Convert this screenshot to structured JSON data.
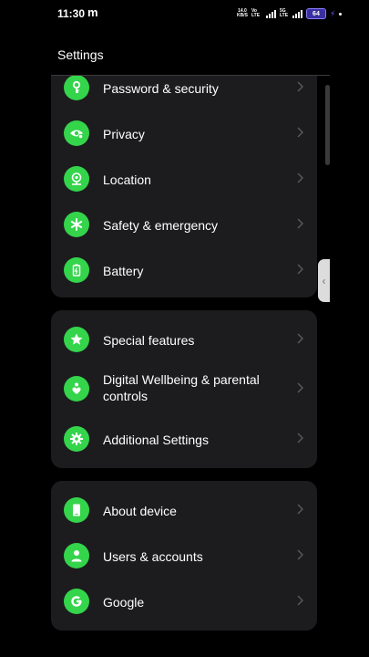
{
  "status_bar": {
    "time": "11:30",
    "app_indicator": "m",
    "net_speed_value": "14.0",
    "net_speed_unit": "KB/S",
    "network_type_1": "Vo LTE",
    "network_type_2": "5G LTE",
    "battery_level": "64"
  },
  "header": {
    "title": "Settings"
  },
  "groups": [
    {
      "items": [
        {
          "label": "Password & security",
          "icon": "key-icon"
        },
        {
          "label": "Privacy",
          "icon": "privacy-eye-icon"
        },
        {
          "label": "Location",
          "icon": "location-pin-icon"
        },
        {
          "label": "Safety & emergency",
          "icon": "asterisk-icon"
        },
        {
          "label": "Battery",
          "icon": "battery-icon"
        }
      ]
    },
    {
      "items": [
        {
          "label": "Special features",
          "icon": "star-icon"
        },
        {
          "label": "Digital Wellbeing & parental controls",
          "icon": "wellbeing-heart-icon"
        },
        {
          "label": "Additional Settings",
          "icon": "gear-icon"
        }
      ]
    },
    {
      "items": [
        {
          "label": "About device",
          "icon": "phone-icon"
        },
        {
          "label": "Users & accounts",
          "icon": "user-icon"
        },
        {
          "label": "Google",
          "icon": "google-icon"
        }
      ]
    }
  ],
  "colors": {
    "accent": "#34d44b",
    "card_background": "#1c1c1e",
    "background": "#000000"
  }
}
